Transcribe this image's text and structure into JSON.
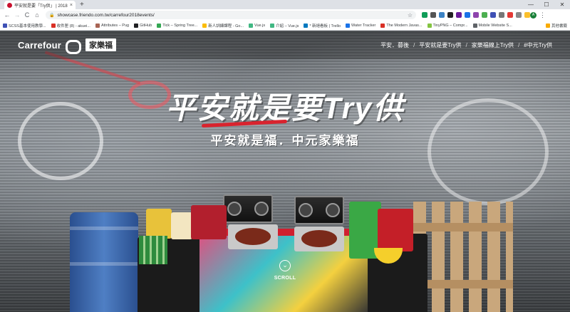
{
  "browser": {
    "tab": {
      "title": "平安就是要「Try供」 | 2018中",
      "close": "×"
    },
    "new_tab": "+",
    "window_controls": [
      "—",
      "☐",
      "✕"
    ],
    "nav": {
      "back": "←",
      "forward": "→",
      "reload": "C",
      "home": "⌂"
    },
    "address": {
      "lock": "🔒",
      "url": "showcase.friendo.com.tw/carrefour2018events/",
      "star": "☆"
    },
    "profile_initial": "A",
    "menu": "⋮",
    "extension_colors": [
      "#0f9d58",
      "#555555",
      "#3b82c4",
      "#222222",
      "#6a1b9a",
      "#1a73e8",
      "#8e44ad",
      "#4caf50",
      "#3f51b5",
      "#777777",
      "#e53935",
      "#888888",
      "#fbc02d"
    ],
    "bookmarks": [
      {
        "label": "SCSS基本使用教學...",
        "color": "#3f51b5"
      },
      {
        "label": "收件匣 (8) - akuei...",
        "color": "#d93025"
      },
      {
        "label": "Attributes – Pug",
        "color": "#a86454"
      },
      {
        "label": "GitHub",
        "color": "#202124"
      },
      {
        "label": "Tick – Spring Tree...",
        "color": "#34a853"
      },
      {
        "label": "新人訓練課程 - Go...",
        "color": "#fbbc04"
      },
      {
        "label": "Vue.js",
        "color": "#41b883"
      },
      {
        "label": "介紹 – Vue.js",
        "color": "#41b883"
      },
      {
        "label": "* 新絕看板 | Trello",
        "color": "#0079bf"
      },
      {
        "label": "Water Tracker",
        "color": "#1a73e8"
      },
      {
        "label": "The Modern Javas...",
        "color": "#d93025"
      },
      {
        "label": "TinyPNG – Compr...",
        "color": "#84c441"
      },
      {
        "label": "Mobile Website S...",
        "color": "#5f6368"
      }
    ],
    "other_bookmarks": "其他書籤"
  },
  "site": {
    "brand_en": "Carrefour",
    "brand_cn": "家樂福",
    "nav": [
      "平安．募後",
      "平安就是要Try供",
      "家樂福線上Try供",
      "#中元Try供"
    ],
    "nav_sep": "/",
    "hero_title": "平安就是要Try供",
    "hero_subtitle": "平安就是福．中元家樂福",
    "scroll_icon": "⌄",
    "scroll_label": "SCROLL"
  }
}
